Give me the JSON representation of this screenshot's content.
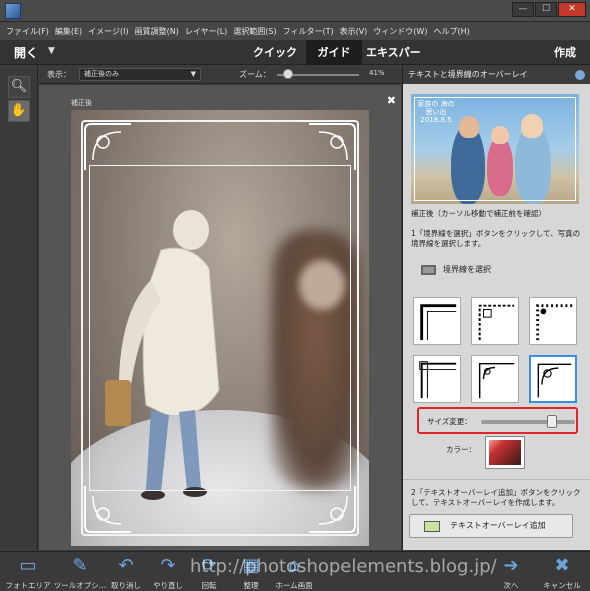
{
  "menu": [
    "ファイル(F)",
    "編集(E)",
    "イメージ(I)",
    "画質調整(N)",
    "レイヤー(L)",
    "選択範囲(S)",
    "フィルター(T)",
    "表示(V)",
    "ウィンドウ(W)",
    "ヘルプ(H)"
  ],
  "modebar": {
    "open_label": "開く",
    "tabs": [
      "クイック",
      "ガイド",
      "エキスパート"
    ],
    "active_tab": "ガイド",
    "create_label": "作成"
  },
  "options": {
    "view_label": "表示：",
    "view_value": "補正後のみ",
    "zoom_label": "ズーム：",
    "zoom_value": "41%"
  },
  "canvas": {
    "label": "補正後",
    "close": "✖"
  },
  "panel": {
    "title": "テキストと境界線のオーバーレイ",
    "preview_stamp": "家族の 海の 思い出 2018.8.5",
    "preview_caption": "補正後（カーソル移動で補正前を確認）",
    "step1": "1「境界線を選択」ボタンをクリックして、写真の境界線を選択します。",
    "border_select_label": "境界線を選択",
    "size_label": "サイズ変更：",
    "size_level": 0.72,
    "color_label": "カラー：",
    "step2": "2「テキストオーバーレイ追加」ボタンをクリックして、テキストオーバーレイを作成します。",
    "text_overlay_button": "テキストオーバーレイ追加"
  },
  "bottombar": {
    "items": [
      "フォトエリア",
      "ツールオプシ…",
      "取り消し",
      "やり直し",
      "回転",
      "整理",
      "ホーム画面",
      "次へ",
      "キャンセル"
    ]
  },
  "watermark": "http://photoshopelements.blog.jp/",
  "colors": {
    "close_red": "#c6372b",
    "highlight_red": "#e0232a",
    "selection_blue": "#3b8fe0"
  }
}
